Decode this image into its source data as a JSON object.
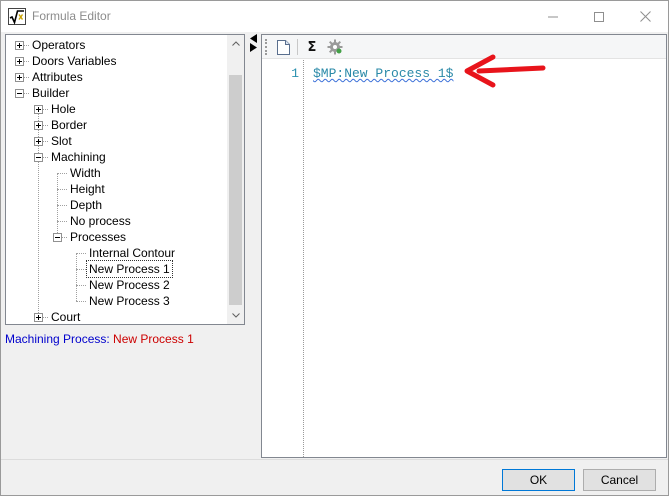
{
  "window": {
    "title": "Formula Editor",
    "app_icon": "square-root-icon"
  },
  "tree": {
    "nodes": [
      {
        "label": "Operators",
        "expander": "plus",
        "level": 0
      },
      {
        "label": "Doors Variables",
        "expander": "plus",
        "level": 0
      },
      {
        "label": "Attributes",
        "expander": "plus",
        "level": 0
      },
      {
        "label": "Builder",
        "expander": "minus",
        "level": 0
      },
      {
        "label": "Hole",
        "expander": "plus",
        "level": 1
      },
      {
        "label": "Border",
        "expander": "plus",
        "level": 1
      },
      {
        "label": "Slot",
        "expander": "plus",
        "level": 1
      },
      {
        "label": "Machining",
        "expander": "minus",
        "level": 1
      },
      {
        "label": "Width",
        "expander": "none",
        "level": 2
      },
      {
        "label": "Height",
        "expander": "none",
        "level": 2
      },
      {
        "label": "Depth",
        "expander": "none",
        "level": 2
      },
      {
        "label": "No process",
        "expander": "none",
        "level": 2
      },
      {
        "label": "Processes",
        "expander": "minus",
        "level": 2
      },
      {
        "label": "Internal Contour",
        "expander": "none",
        "level": 3
      },
      {
        "label": "New Process 1",
        "expander": "none",
        "level": 3,
        "selected": true
      },
      {
        "label": "New Process 2",
        "expander": "none",
        "level": 3
      },
      {
        "label": "New Process 3",
        "expander": "none",
        "level": 3
      },
      {
        "label": "Court",
        "expander": "plus",
        "level": 1
      }
    ]
  },
  "status": {
    "label": "Machining Process: ",
    "value": "New Process 1"
  },
  "toolbar": {
    "new_icon": "new-document-icon",
    "sigma_label": "Σ",
    "settings_icon": "gear-icon"
  },
  "editor": {
    "line_number": "1",
    "code": "$MP:New Process 1$"
  },
  "annotation": {
    "arrow_color": "#e8141b"
  },
  "buttons": {
    "ok": "OK",
    "cancel": "Cancel"
  }
}
